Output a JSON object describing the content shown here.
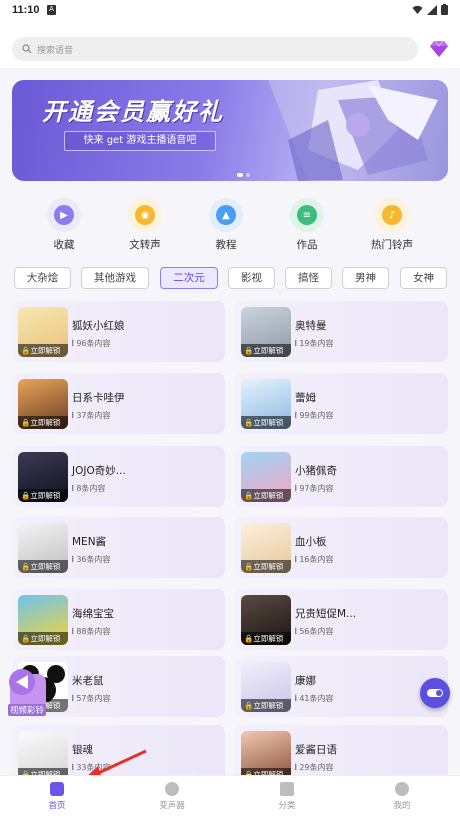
{
  "status": {
    "time": "11:10",
    "notification": "A"
  },
  "search": {
    "placeholder": "搜索语音"
  },
  "banner": {
    "title": "开通会员赢好礼",
    "subtitle": "快来 get 游戏主播语音吧"
  },
  "quick_actions": [
    {
      "label": "收藏",
      "icon": "play-icon",
      "color": "#8b7cf0",
      "bg": "#ece9fb"
    },
    {
      "label": "文转声",
      "icon": "coin-icon",
      "color": "#f5b82e",
      "bg": "#fdf2da"
    },
    {
      "label": "教程",
      "icon": "graduation-cap-icon",
      "color": "#4a9ef2",
      "bg": "#e2eefb"
    },
    {
      "label": "作品",
      "icon": "layers-icon",
      "color": "#3dbd7d",
      "bg": "#dff3e9"
    },
    {
      "label": "热门铃声",
      "icon": "music-note-icon",
      "color": "#f5b82e",
      "bg": "#fdf2da"
    }
  ],
  "categories": [
    "大杂烩",
    "其他游戏",
    "二次元",
    "影视",
    "搞怪",
    "男神",
    "女神"
  ],
  "active_category": "二次元",
  "items": [
    {
      "title": "狐妖小红娘",
      "count": "96条内容",
      "unlock": "立即解锁"
    },
    {
      "title": "奥特曼",
      "count": "19条内容",
      "unlock": "立即解锁"
    },
    {
      "title": "日系卡哇伊",
      "count": "37条内容",
      "unlock": "立即解锁"
    },
    {
      "title": "蕾姆",
      "count": "99条内容",
      "unlock": "立即解锁"
    },
    {
      "title": "JOJO奇妙...",
      "count": "8条内容",
      "unlock": "立即解锁"
    },
    {
      "title": "小猪佩奇",
      "count": "97条内容",
      "unlock": "立即解锁"
    },
    {
      "title": "MEN酱",
      "count": "36条内容",
      "unlock": "立即解锁"
    },
    {
      "title": "血小板",
      "count": "16条内容",
      "unlock": "立即解锁"
    },
    {
      "title": "海绵宝宝",
      "count": "88条内容",
      "unlock": "立即解锁"
    },
    {
      "title": "兄贵短促M...",
      "count": "56条内容",
      "unlock": "立即解锁"
    },
    {
      "title": "米老鼠",
      "count": "57条内容",
      "unlock": "立即解锁"
    },
    {
      "title": "康娜",
      "count": "41条内容",
      "unlock": "立即解锁"
    },
    {
      "title": "银魂",
      "count": "33条内容",
      "unlock": "立即解锁"
    },
    {
      "title": "爱酱日语",
      "count": "29条内容",
      "unlock": "立即解锁"
    }
  ],
  "floating": {
    "video_label": "视频彩铃"
  },
  "nav": [
    {
      "label": "首页",
      "active": true
    },
    {
      "label": "变声器",
      "active": false
    },
    {
      "label": "分类",
      "active": false
    },
    {
      "label": "我的",
      "active": false
    }
  ],
  "colors": {
    "accent": "#6a57ea",
    "card_bg": "#efebf9"
  }
}
